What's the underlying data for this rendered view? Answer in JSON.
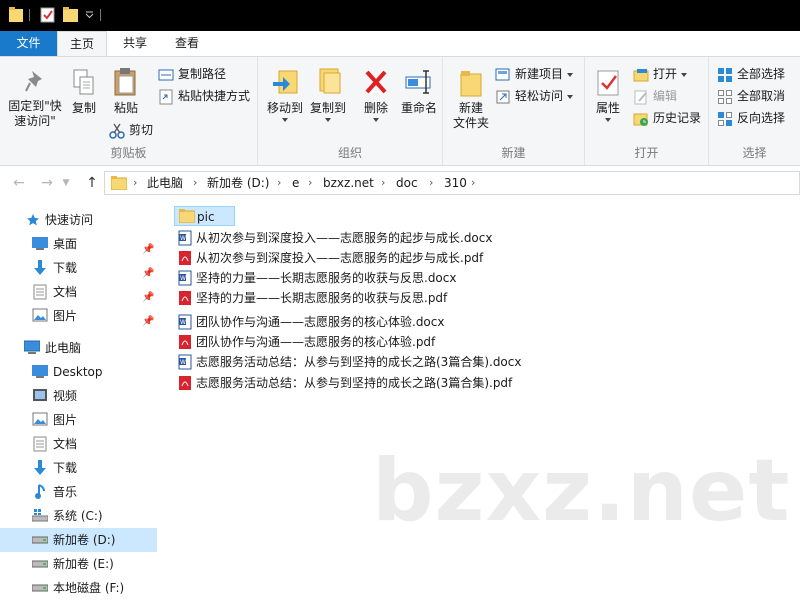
{
  "ribbon_tabs": {
    "file": "文件",
    "home": "主页",
    "share": "共享",
    "view": "查看"
  },
  "clipboard": {
    "group_label": "剪贴板",
    "pin_line1": "固定到\"快",
    "pin_line2": "速访问\"",
    "copy": "复制",
    "paste": "粘贴",
    "copy_path": "复制路径",
    "paste_shortcut": "粘贴快捷方式",
    "cut": "剪切"
  },
  "organize": {
    "group_label": "组织",
    "move_to": "移动到",
    "copy_to": "复制到",
    "delete": "删除",
    "rename": "重命名"
  },
  "new_group": {
    "group_label": "新建",
    "new_folder_line1": "新建",
    "new_folder_line2": "文件夹",
    "new_item": "新建项目",
    "easy_access": "轻松访问"
  },
  "open_group": {
    "group_label": "打开",
    "properties": "属性",
    "open": "打开",
    "edit": "编辑",
    "history": "历史记录"
  },
  "select_group": {
    "group_label": "选择",
    "select_all": "全部选择",
    "select_none": "全部取消",
    "invert": "反向选择"
  },
  "breadcrumb": [
    "此电脑",
    "新加卷 (D:)",
    "e",
    "bzxz.net",
    "doc",
    "310"
  ],
  "sidebar": {
    "quick_access": "快速访问",
    "quick_items": [
      "桌面",
      "下载",
      "文档",
      "图片"
    ],
    "this_pc": "此电脑",
    "pc_items": [
      "Desktop",
      "视频",
      "图片",
      "文档",
      "下载",
      "音乐",
      "系统 (C:)",
      "新加卷 (D:)",
      "新加卷 (E:)",
      "本地磁盘 (F:)"
    ]
  },
  "files": [
    {
      "name": "pic",
      "type": "folder"
    },
    {
      "name": "从初次参与到深度投入——志愿服务的起步与成长.docx",
      "type": "docx"
    },
    {
      "name": "从初次参与到深度投入——志愿服务的起步与成长.pdf",
      "type": "pdf"
    },
    {
      "name": "坚持的力量——长期志愿服务的收获与反思.docx",
      "type": "docx"
    },
    {
      "name": "坚持的力量——长期志愿服务的收获与反思.pdf",
      "type": "pdf"
    },
    {
      "name": "团队协作与沟通——志愿服务的核心体验.docx",
      "type": "docx"
    },
    {
      "name": "团队协作与沟通——志愿服务的核心体验.pdf",
      "type": "pdf"
    },
    {
      "name": "志愿服务活动总结：从参与到坚持的成长之路(3篇合集).docx",
      "type": "docx"
    },
    {
      "name": "志愿服务活动总结：从参与到坚持的成长之路(3篇合集).pdf",
      "type": "pdf"
    }
  ],
  "watermark": "bzxz.net",
  "colors": {
    "accent": "#1979ca",
    "selection": "#cce8ff",
    "folder": "#f8d775",
    "pdf": "#d9232e",
    "word": "#2b579a"
  }
}
